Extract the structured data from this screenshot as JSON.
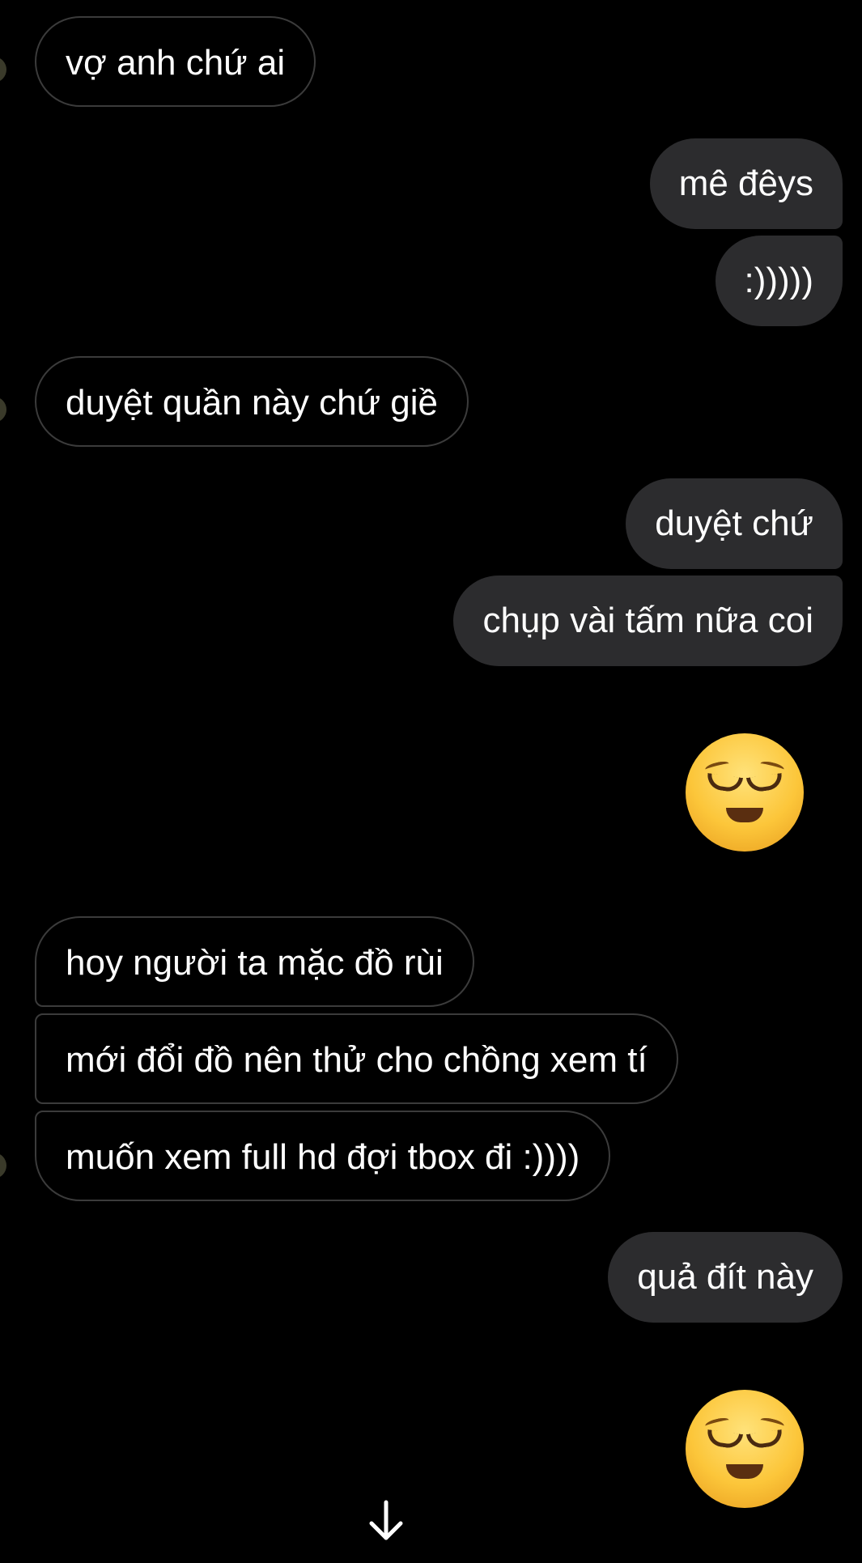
{
  "messages": [
    {
      "id": "m1",
      "side": "in",
      "text": "vợ anh chứ ai"
    },
    {
      "id": "m2",
      "side": "out",
      "text": "mê đêys"
    },
    {
      "id": "m3",
      "side": "out",
      "text": ":)))))"
    },
    {
      "id": "m4",
      "side": "in",
      "text": "duyệt quần này chứ giề"
    },
    {
      "id": "m5",
      "side": "out",
      "text": "duyệt chứ"
    },
    {
      "id": "m6",
      "side": "out",
      "text": "chụp vài tấm nữa coi"
    },
    {
      "id": "m7",
      "side": "out",
      "emoji": "relieved-face-icon"
    },
    {
      "id": "m8",
      "side": "in",
      "text": "hoy người ta mặc đồ rùi"
    },
    {
      "id": "m9",
      "side": "in",
      "text": "mới đổi đồ nên thử cho chồng xem tí"
    },
    {
      "id": "m10",
      "side": "in",
      "text": "muốn xem full hd đợi tbox đi :))))"
    },
    {
      "id": "m11",
      "side": "out",
      "text": "quả đít này"
    },
    {
      "id": "m12",
      "side": "out",
      "emoji": "relieved-face-icon"
    }
  ],
  "scroll_button": {
    "icon": "arrow-down-icon"
  },
  "colors": {
    "background": "#000000",
    "outgoing_bubble": "#2c2c2e",
    "incoming_border": "#3b3b3b",
    "text": "#ffffff"
  }
}
